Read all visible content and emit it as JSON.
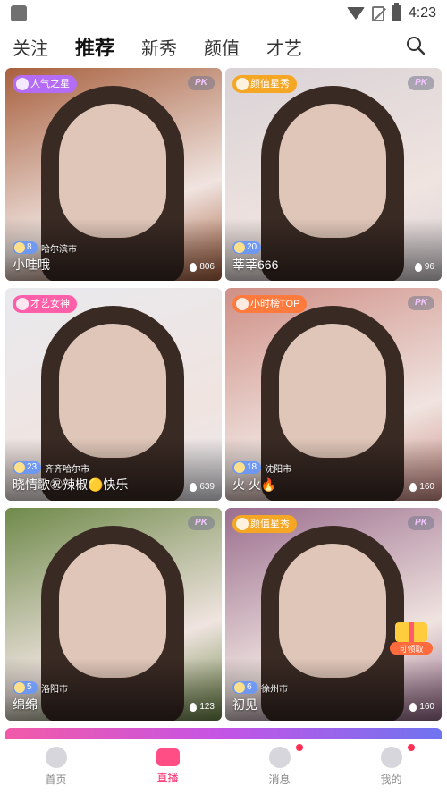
{
  "status_bar": {
    "time": "4:23"
  },
  "tabs": [
    {
      "label": "关注",
      "active": false
    },
    {
      "label": "推荐",
      "active": true
    },
    {
      "label": "新秀",
      "active": false
    },
    {
      "label": "颜值",
      "active": false
    },
    {
      "label": "才艺",
      "active": false
    }
  ],
  "cards": [
    {
      "badge": "人气之星",
      "badge_color": "#b46cf5",
      "pk": "PK",
      "level": "8",
      "city": "哈尔滨市",
      "name": "小哇哦",
      "heat": "806",
      "bg": "#a8603e"
    },
    {
      "badge": "颜值星秀",
      "badge_color": "#f5a623",
      "pk": "PK",
      "level": "20",
      "city": "",
      "name": "莘莘666",
      "heat": "96",
      "bg": "#d9d2d6"
    },
    {
      "badge": "才艺女神",
      "badge_color": "#ff5fa8",
      "pk": "",
      "level": "23",
      "city": "齐齐哈尔市",
      "name": "晓情歌㊗辣椒🟡快乐",
      "heat": "639",
      "bg": "#e9e9ee"
    },
    {
      "badge": "小时榜TOP",
      "badge_color": "#ff7a3d",
      "pk": "PK",
      "level": "18",
      "city": "沈阳市",
      "name": "火 火🔥",
      "heat": "160",
      "bg": "#cf8f86"
    },
    {
      "badge": "",
      "badge_color": "",
      "pk": "PK",
      "level": "5",
      "city": "洛阳市",
      "name": "绵绵",
      "heat": "123",
      "bg": "#6f8a4a"
    },
    {
      "badge": "颜值星秀",
      "badge_color": "#f5a623",
      "pk": "PK",
      "level": "6",
      "city": "徐州市",
      "name": "初见",
      "heat": "160",
      "bg": "#9b6e8e"
    }
  ],
  "gift_label": "可领取",
  "bottom_nav": [
    {
      "label": "首页",
      "active": false,
      "dot": false
    },
    {
      "label": "直播",
      "active": true,
      "dot": false
    },
    {
      "label": "消息",
      "active": false,
      "dot": true
    },
    {
      "label": "我的",
      "active": false,
      "dot": true
    }
  ],
  "colors": {
    "accent": "#ff2f6e",
    "badge_purple": "#b46cf5",
    "badge_orange": "#f5a623"
  }
}
